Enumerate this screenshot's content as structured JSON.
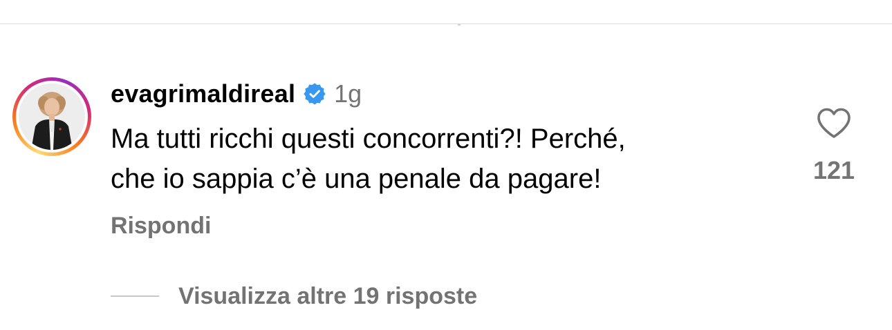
{
  "comment": {
    "username": "evagrimaldireal",
    "verified": true,
    "timestamp": "1g",
    "text": "Ma tutti ricchi questi concorrenti?! Perché,\nche io sappia c’è una penale da pagare!",
    "reply_label": "Rispondi",
    "like_count": "121",
    "view_replies_label": "Visualizza altre 19 risposte"
  },
  "icons": {
    "verified": "verified-badge-icon",
    "like": "heart-outline-icon"
  },
  "colors": {
    "verified_blue": "#3897f0",
    "secondary_text": "#737373",
    "primary_text": "#000000",
    "divider": "#dbdbdb"
  }
}
